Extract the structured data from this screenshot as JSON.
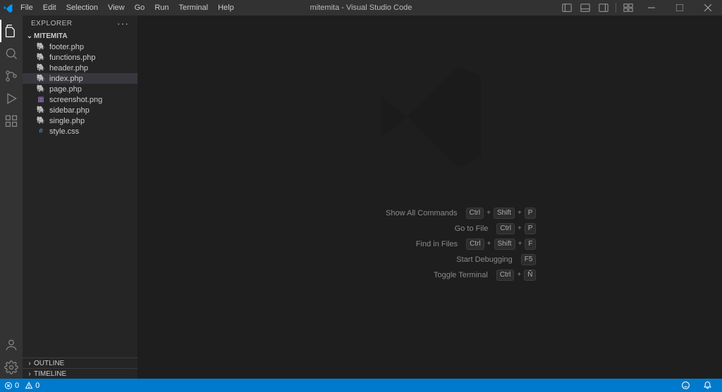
{
  "titlebar": {
    "menu": [
      "File",
      "Edit",
      "Selection",
      "View",
      "Go",
      "Run",
      "Terminal",
      "Help"
    ],
    "title": "mitemita - Visual Studio Code"
  },
  "sidebar": {
    "header": "EXPLORER",
    "folder": "MITEMITA",
    "files": [
      {
        "name": "footer.php",
        "icon": "php"
      },
      {
        "name": "functions.php",
        "icon": "php"
      },
      {
        "name": "header.php",
        "icon": "php"
      },
      {
        "name": "index.php",
        "icon": "php",
        "active": true
      },
      {
        "name": "page.php",
        "icon": "php"
      },
      {
        "name": "screenshot.png",
        "icon": "img"
      },
      {
        "name": "sidebar.php",
        "icon": "php"
      },
      {
        "name": "single.php",
        "icon": "php"
      },
      {
        "name": "style.css",
        "icon": "css"
      }
    ],
    "sections": [
      "OUTLINE",
      "TIMELINE"
    ]
  },
  "welcome": {
    "shortcuts": [
      {
        "label": "Show All Commands",
        "keys": [
          "Ctrl",
          "Shift",
          "P"
        ]
      },
      {
        "label": "Go to File",
        "keys": [
          "Ctrl",
          "P"
        ]
      },
      {
        "label": "Find in Files",
        "keys": [
          "Ctrl",
          "Shift",
          "F"
        ]
      },
      {
        "label": "Start Debugging",
        "keys": [
          "F5"
        ]
      },
      {
        "label": "Toggle Terminal",
        "keys": [
          "Ctrl",
          "Ñ"
        ]
      }
    ]
  },
  "statusbar": {
    "errors": "0",
    "warnings": "0"
  }
}
